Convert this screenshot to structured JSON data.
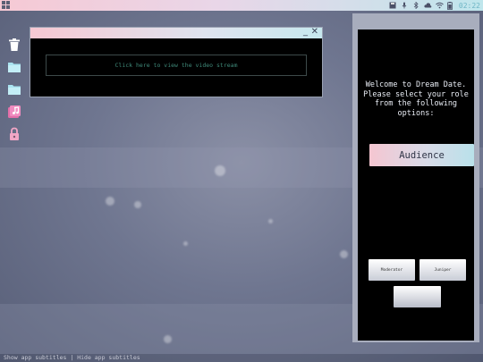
{
  "topbar": {
    "menu_icon": "grid-icon",
    "tray_icons": [
      "save-icon",
      "microphone-icon",
      "bluetooth-icon",
      "cloud-icon",
      "wifi-icon",
      "battery-icon"
    ],
    "clock": "02:22"
  },
  "desktop": {
    "icons": [
      "trash-icon",
      "folder-icon",
      "folder-icon",
      "music-library-icon",
      "lock-icon"
    ]
  },
  "video_window": {
    "minimize_glyph": "_",
    "close_glyph": "✕",
    "stream_prompt": "Click here to view the video stream"
  },
  "panel": {
    "welcome_text": "Welcome to Dream Date. Please select your role from the following options:",
    "audience_label": "Audience",
    "moderator_label": "Moderator",
    "juniper_label": "Juniper",
    "blank_label": ""
  },
  "subtitles": {
    "show_label": "Show app subtitles",
    "separator": " | ",
    "hide_label": "Hide app subtitles"
  },
  "colors": {
    "accent_pink": "#f5c6d1",
    "accent_cyan": "#b9e1ea",
    "clock": "#6fb6c6"
  }
}
